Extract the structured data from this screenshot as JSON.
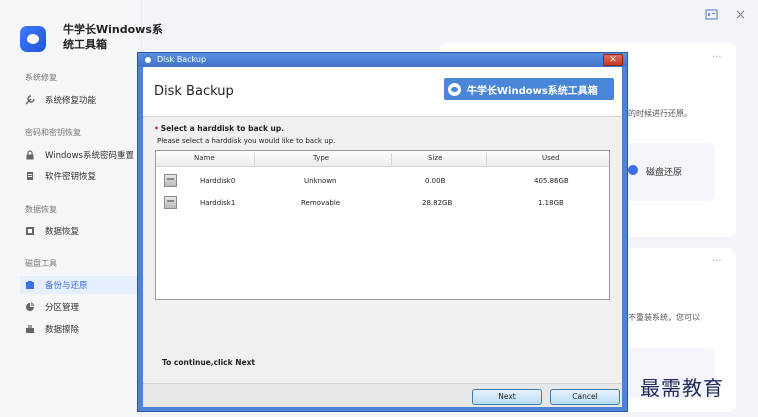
{
  "app": {
    "title_line1": "牛学长Windows系",
    "title_line2": "统工具箱"
  },
  "sidebar": {
    "sections": [
      {
        "label": "系统修复"
      },
      {
        "label": "密码和密钥恢复"
      },
      {
        "label": "数据恢复"
      },
      {
        "label": "磁盘工具"
      }
    ],
    "items": [
      {
        "label": "系统修复功能"
      },
      {
        "label": "Windows系统密码重置"
      },
      {
        "label": "软件密钥恢复"
      },
      {
        "label": "数据恢复"
      },
      {
        "label": "备份与还原"
      },
      {
        "label": "分区管理"
      },
      {
        "label": "数据擦除"
      }
    ]
  },
  "background_panels": {
    "text_top": "的时候进行还原。",
    "restore_card_label": "磁盘还原",
    "text_bottom": "不重装系统，您可以",
    "more_dots": "···"
  },
  "dialog": {
    "window_title": "Disk Backup",
    "close_glyph": "✕",
    "header_title": "Disk Backup",
    "brand_label": "牛学长Windows系统工具箱",
    "select_title": "Select a harddisk to back up.",
    "select_sub": "Please select a harddisk you would like to back up.",
    "columns": [
      "Name",
      "Type",
      "Size",
      "Used"
    ],
    "rows": [
      {
        "name": "Harddisk0",
        "type": "Unknown",
        "size": "0.00B",
        "used": "405.86GB"
      },
      {
        "name": "Harddisk1",
        "type": "Removable",
        "size": "28.82GB",
        "used": "1.18GB"
      }
    ],
    "continue_text": "To continue,click Next",
    "next_label": "Next",
    "cancel_label": "Cancel"
  },
  "watermark": "最需教育",
  "colors": {
    "accent": "#3b6ee8",
    "dialog_frame": "#4d82d4",
    "brand_bar": "#4a86d8",
    "close_red": "#c43a28"
  }
}
